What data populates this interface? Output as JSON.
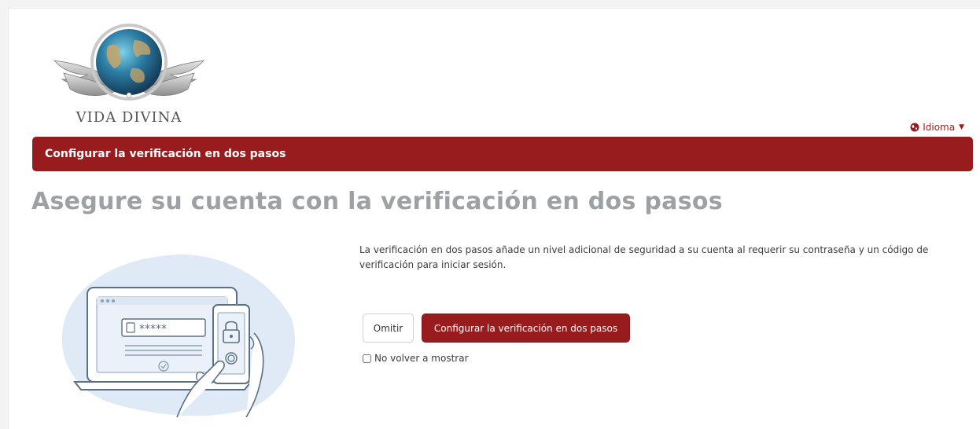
{
  "logo": {
    "text": "VIDA DIVINA"
  },
  "language": {
    "label": "Idioma",
    "icon": "globe-icon"
  },
  "banner": {
    "title": "Configurar la verificación en dos pasos"
  },
  "main": {
    "heading": "Asegure su cuenta con la verificación en dos pasos",
    "description": "La verificación en dos pasos añade un nivel adicional de seguridad a su cuenta al requerir su contraseña y un código de verificación para iniciar sesión.",
    "skip_button": "Omitir",
    "setup_button": "Configurar la verificación en dos pasos",
    "dont_show_label": "No volver a mostrar",
    "dont_show_checked": false
  },
  "colors": {
    "brand_red": "#981b1e",
    "heading_gray": "#9ea1a4",
    "illustration_blue": "#dfeaf6"
  }
}
